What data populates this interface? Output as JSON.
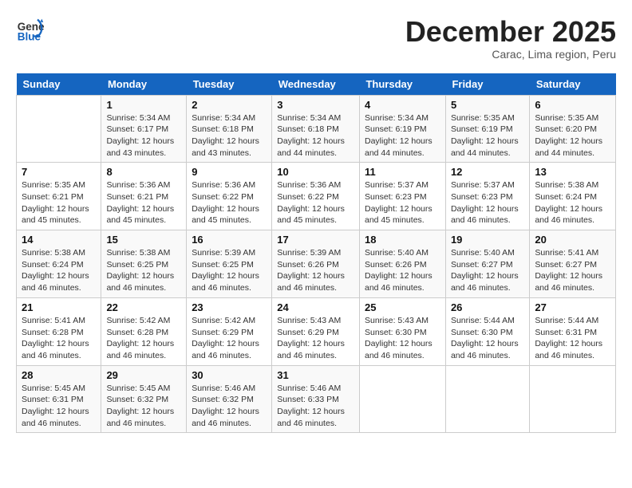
{
  "header": {
    "logo_line1": "General",
    "logo_line2": "Blue",
    "month": "December 2025",
    "location": "Carac, Lima region, Peru"
  },
  "weekdays": [
    "Sunday",
    "Monday",
    "Tuesday",
    "Wednesday",
    "Thursday",
    "Friday",
    "Saturday"
  ],
  "weeks": [
    [
      {
        "day": "",
        "info": ""
      },
      {
        "day": "1",
        "info": "Sunrise: 5:34 AM\nSunset: 6:17 PM\nDaylight: 12 hours\nand 43 minutes."
      },
      {
        "day": "2",
        "info": "Sunrise: 5:34 AM\nSunset: 6:18 PM\nDaylight: 12 hours\nand 43 minutes."
      },
      {
        "day": "3",
        "info": "Sunrise: 5:34 AM\nSunset: 6:18 PM\nDaylight: 12 hours\nand 44 minutes."
      },
      {
        "day": "4",
        "info": "Sunrise: 5:34 AM\nSunset: 6:19 PM\nDaylight: 12 hours\nand 44 minutes."
      },
      {
        "day": "5",
        "info": "Sunrise: 5:35 AM\nSunset: 6:19 PM\nDaylight: 12 hours\nand 44 minutes."
      },
      {
        "day": "6",
        "info": "Sunrise: 5:35 AM\nSunset: 6:20 PM\nDaylight: 12 hours\nand 44 minutes."
      }
    ],
    [
      {
        "day": "7",
        "info": "Sunrise: 5:35 AM\nSunset: 6:21 PM\nDaylight: 12 hours\nand 45 minutes."
      },
      {
        "day": "8",
        "info": "Sunrise: 5:36 AM\nSunset: 6:21 PM\nDaylight: 12 hours\nand 45 minutes."
      },
      {
        "day": "9",
        "info": "Sunrise: 5:36 AM\nSunset: 6:22 PM\nDaylight: 12 hours\nand 45 minutes."
      },
      {
        "day": "10",
        "info": "Sunrise: 5:36 AM\nSunset: 6:22 PM\nDaylight: 12 hours\nand 45 minutes."
      },
      {
        "day": "11",
        "info": "Sunrise: 5:37 AM\nSunset: 6:23 PM\nDaylight: 12 hours\nand 45 minutes."
      },
      {
        "day": "12",
        "info": "Sunrise: 5:37 AM\nSunset: 6:23 PM\nDaylight: 12 hours\nand 46 minutes."
      },
      {
        "day": "13",
        "info": "Sunrise: 5:38 AM\nSunset: 6:24 PM\nDaylight: 12 hours\nand 46 minutes."
      }
    ],
    [
      {
        "day": "14",
        "info": "Sunrise: 5:38 AM\nSunset: 6:24 PM\nDaylight: 12 hours\nand 46 minutes."
      },
      {
        "day": "15",
        "info": "Sunrise: 5:38 AM\nSunset: 6:25 PM\nDaylight: 12 hours\nand 46 minutes."
      },
      {
        "day": "16",
        "info": "Sunrise: 5:39 AM\nSunset: 6:25 PM\nDaylight: 12 hours\nand 46 minutes."
      },
      {
        "day": "17",
        "info": "Sunrise: 5:39 AM\nSunset: 6:26 PM\nDaylight: 12 hours\nand 46 minutes."
      },
      {
        "day": "18",
        "info": "Sunrise: 5:40 AM\nSunset: 6:26 PM\nDaylight: 12 hours\nand 46 minutes."
      },
      {
        "day": "19",
        "info": "Sunrise: 5:40 AM\nSunset: 6:27 PM\nDaylight: 12 hours\nand 46 minutes."
      },
      {
        "day": "20",
        "info": "Sunrise: 5:41 AM\nSunset: 6:27 PM\nDaylight: 12 hours\nand 46 minutes."
      }
    ],
    [
      {
        "day": "21",
        "info": "Sunrise: 5:41 AM\nSunset: 6:28 PM\nDaylight: 12 hours\nand 46 minutes."
      },
      {
        "day": "22",
        "info": "Sunrise: 5:42 AM\nSunset: 6:28 PM\nDaylight: 12 hours\nand 46 minutes."
      },
      {
        "day": "23",
        "info": "Sunrise: 5:42 AM\nSunset: 6:29 PM\nDaylight: 12 hours\nand 46 minutes."
      },
      {
        "day": "24",
        "info": "Sunrise: 5:43 AM\nSunset: 6:29 PM\nDaylight: 12 hours\nand 46 minutes."
      },
      {
        "day": "25",
        "info": "Sunrise: 5:43 AM\nSunset: 6:30 PM\nDaylight: 12 hours\nand 46 minutes."
      },
      {
        "day": "26",
        "info": "Sunrise: 5:44 AM\nSunset: 6:30 PM\nDaylight: 12 hours\nand 46 minutes."
      },
      {
        "day": "27",
        "info": "Sunrise: 5:44 AM\nSunset: 6:31 PM\nDaylight: 12 hours\nand 46 minutes."
      }
    ],
    [
      {
        "day": "28",
        "info": "Sunrise: 5:45 AM\nSunset: 6:31 PM\nDaylight: 12 hours\nand 46 minutes."
      },
      {
        "day": "29",
        "info": "Sunrise: 5:45 AM\nSunset: 6:32 PM\nDaylight: 12 hours\nand 46 minutes."
      },
      {
        "day": "30",
        "info": "Sunrise: 5:46 AM\nSunset: 6:32 PM\nDaylight: 12 hours\nand 46 minutes."
      },
      {
        "day": "31",
        "info": "Sunrise: 5:46 AM\nSunset: 6:33 PM\nDaylight: 12 hours\nand 46 minutes."
      },
      {
        "day": "",
        "info": ""
      },
      {
        "day": "",
        "info": ""
      },
      {
        "day": "",
        "info": ""
      }
    ]
  ]
}
